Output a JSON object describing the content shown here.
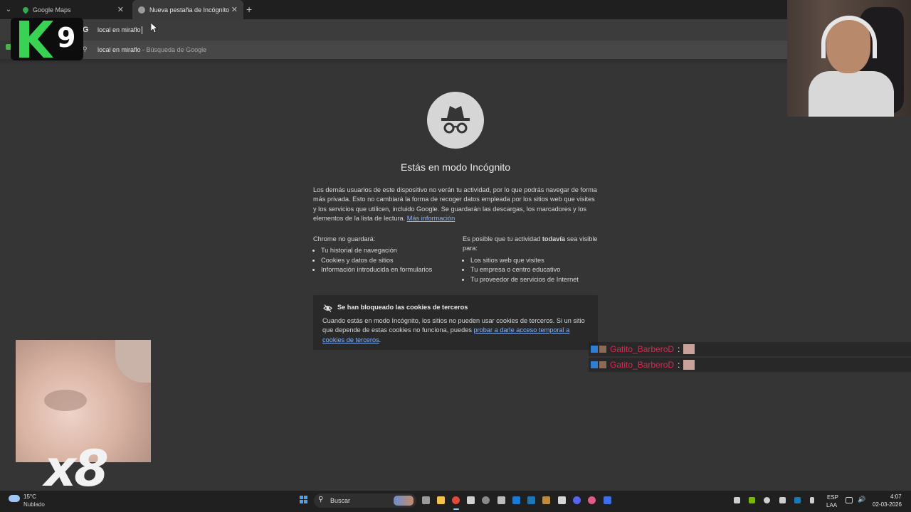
{
  "browser": {
    "tabs": [
      {
        "title": "Google Maps",
        "icon": "maps-pin-icon"
      },
      {
        "title": "Nueva pestaña de Incógnito",
        "icon": "incognito-icon"
      }
    ],
    "omnibox": {
      "value": "local en miraflo"
    },
    "suggestion": {
      "query": "local en miraflo",
      "suffix": " - Búsqueda de Google"
    }
  },
  "overlay": {
    "logo_number": "9",
    "multiplier": "x8",
    "chat": [
      {
        "user": "Gatito_BarberoD",
        "sep": ":"
      },
      {
        "user": "Gatito_BarberoD",
        "sep": ":"
      }
    ]
  },
  "incognito": {
    "title": "Estás en modo Incógnito",
    "intro": "Los demás usuarios de este dispositivo no verán tu actividad, por lo que podrás navegar de forma más privada. Esto no cambiará la forma de recoger datos empleada por los sitios web que visites y los servicios que utilicen, incluido Google. Se guardarán las descargas, los marcadores y los elementos de la lista de lectura.",
    "more_info": "Más información",
    "col1_heading": "Chrome no guardará:",
    "col1_items": [
      "Tu historial de navegación",
      "Cookies y datos de sitios",
      "Información introducida en formularios"
    ],
    "col2_heading_pre": "Es posible que tu actividad ",
    "col2_heading_bold": "todavía",
    "col2_heading_post": " sea visible para:",
    "col2_items": [
      "Los sitios web que visites",
      "Tu empresa o centro educativo",
      "Tu proveedor de servicios de Internet"
    ],
    "cookie_title": "Se han bloqueado las cookies de terceros",
    "cookie_body": "Cuando estás en modo Incógnito, los sitios no pueden usar cookies de terceros. Si un sitio que depende de estas cookies no funciona, puedes ",
    "cookie_link": "probar a darle acceso temporal a cookies de terceros",
    "cookie_end": "."
  },
  "taskbar": {
    "temperature": "15°C",
    "condition": "Nublado",
    "search_label": "Buscar",
    "lang1": "ESP",
    "lang2": "LAA",
    "time": "4:07",
    "date": "02-03-2026"
  },
  "colors": {
    "accent_link": "#8ab4f8",
    "chat_user": "#e0264f",
    "k9_green": "#39d353"
  }
}
